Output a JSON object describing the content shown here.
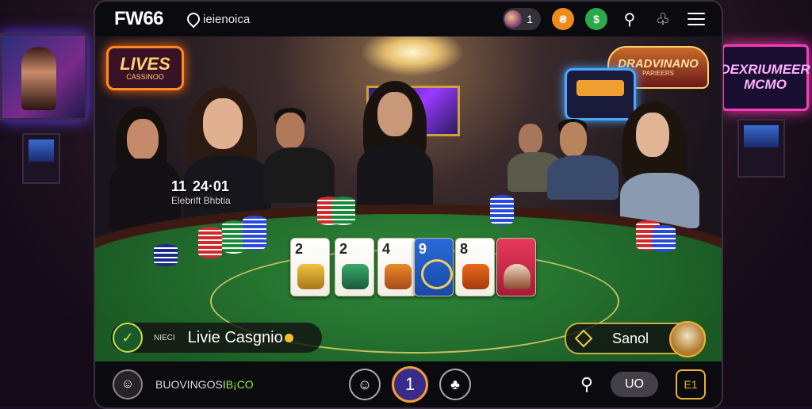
{
  "topbar": {
    "brand": "FW66",
    "location": "ieienoica",
    "badge_count": "1",
    "icons": [
      "user-avatar-icon",
      "coin-icon",
      "dollar-icon",
      "search-icon",
      "club-icon",
      "menu-icon"
    ]
  },
  "signs": {
    "lives_big": "LIVES",
    "lives_small": "CASSINOO",
    "right_big": "DRADVINANO",
    "right_small": "PARIEERS",
    "far_right": "DEXRIUMEER\nMCMO"
  },
  "overlay": {
    "big": "11",
    "big_suffix": "24·01",
    "small": "Elebrift Bhbtia"
  },
  "table": {
    "cards": [
      "2",
      "2",
      "4",
      "9",
      "8",
      ""
    ],
    "colors": {
      "felt": "#23702f",
      "rim": "#3a1a12",
      "accent": "#c8b040"
    }
  },
  "live_pill": {
    "micro": "NIECI",
    "title": "Livie Casgnio"
  },
  "send_pill": {
    "label": "Sanol"
  },
  "bottombar": {
    "name_main": "BUOVINGOSI",
    "name_hi": "B¡CO",
    "center_main": "1",
    "uo_label": "UO",
    "square_label": "E1"
  }
}
